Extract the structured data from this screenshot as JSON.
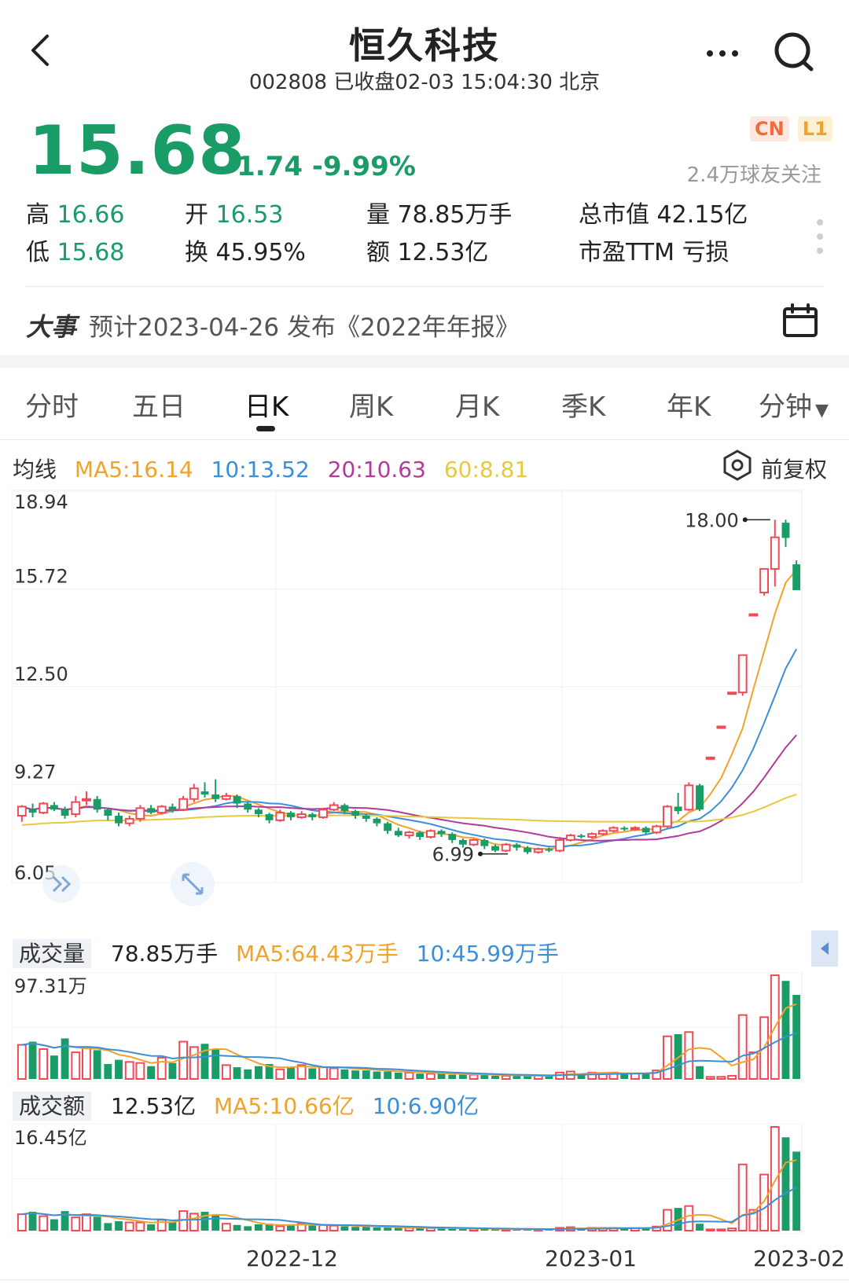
{
  "header": {
    "title": "恒久科技",
    "subtitle": "002808 已收盘02-03 15:04:30 北京"
  },
  "quote": {
    "price": "15.68",
    "change": "-1.74 -9.99%",
    "badges": [
      "CN",
      "L1"
    ],
    "followers": "2.4万球友关注",
    "stats": {
      "high_label": "高",
      "high": "16.66",
      "open_label": "开",
      "open": "16.53",
      "volume_label": "量",
      "volume": "78.85万手",
      "mktcap_label": "总市值",
      "mktcap": "42.15亿",
      "low_label": "低",
      "low": "15.68",
      "turnover_label": "换",
      "turnover": "45.95%",
      "amount_label": "额",
      "amount": "12.53亿",
      "pe_label": "市盈TTM",
      "pe": "亏损"
    }
  },
  "event": {
    "tag": "大事",
    "text": "预计2023-04-26 发布《2022年年报》"
  },
  "tabs": [
    {
      "label": "分时",
      "active": false
    },
    {
      "label": "五日",
      "active": false
    },
    {
      "label": "日K",
      "active": true
    },
    {
      "label": "周K",
      "active": false
    },
    {
      "label": "月K",
      "active": false
    },
    {
      "label": "季K",
      "active": false
    },
    {
      "label": "年K",
      "active": false
    },
    {
      "label": "分钟",
      "active": false
    }
  ],
  "ma_legend": {
    "label": "均线",
    "ma5": "MA5:16.14",
    "ma10": "10:13.52",
    "ma20": "20:10.63",
    "ma60": "60:8.81",
    "adjust": "前复权"
  },
  "volume_legend": {
    "label": "成交量",
    "value": "78.85万手",
    "ma5": "MA5:64.43万手",
    "ma10": "10:45.99万手",
    "axis_max": "97.31万"
  },
  "amount_legend": {
    "label": "成交额",
    "value": "12.53亿",
    "ma5": "MA5:10.66亿",
    "ma10": "10:6.90亿",
    "axis_max": "16.45亿"
  },
  "x_axis": [
    "2022-12",
    "2023-01",
    "2023-02"
  ],
  "colors": {
    "up": "#f24957",
    "down": "#1a9c67",
    "ma5": "#f1a22a",
    "ma10": "#3b8fd9",
    "ma20": "#b13a9a",
    "ma60": "#e8c93c"
  },
  "chart_data": [
    {
      "type": "candlestick",
      "title": "日K",
      "y_ticks": [
        18.94,
        15.72,
        12.5,
        9.27,
        6.05
      ],
      "ylim": [
        6.05,
        18.94
      ],
      "annotations": [
        {
          "label": "18.00",
          "value": 18.0
        },
        {
          "label": "6.99",
          "value": 6.99
        }
      ],
      "candles": [
        [
          8.25,
          8.55,
          8.6,
          8.05
        ],
        [
          8.45,
          8.35,
          8.65,
          8.2
        ],
        [
          8.35,
          8.65,
          8.7,
          8.3
        ],
        [
          8.6,
          8.45,
          8.7,
          8.4
        ],
        [
          8.45,
          8.25,
          8.55,
          8.15
        ],
        [
          8.3,
          8.7,
          8.9,
          8.2
        ],
        [
          8.75,
          8.8,
          9.05,
          8.6
        ],
        [
          8.8,
          8.45,
          8.9,
          8.35
        ],
        [
          8.45,
          8.25,
          8.5,
          8.1
        ],
        [
          8.25,
          8.0,
          8.35,
          7.9
        ],
        [
          8.0,
          8.15,
          8.25,
          7.9
        ],
        [
          8.15,
          8.5,
          8.6,
          8.05
        ],
        [
          8.5,
          8.35,
          8.6,
          8.3
        ],
        [
          8.35,
          8.55,
          8.6,
          8.3
        ],
        [
          8.55,
          8.45,
          8.65,
          8.35
        ],
        [
          8.45,
          8.8,
          8.9,
          8.4
        ],
        [
          8.8,
          9.15,
          9.3,
          8.7
        ],
        [
          9.05,
          8.95,
          9.35,
          8.85
        ],
        [
          8.95,
          8.8,
          9.45,
          8.7
        ],
        [
          8.8,
          8.9,
          9.0,
          8.75
        ],
        [
          8.9,
          8.65,
          8.95,
          8.5
        ],
        [
          8.65,
          8.45,
          8.7,
          8.35
        ],
        [
          8.45,
          8.3,
          8.5,
          8.2
        ],
        [
          8.3,
          8.1,
          8.35,
          8.0
        ],
        [
          8.1,
          8.35,
          8.45,
          8.05
        ],
        [
          8.35,
          8.2,
          8.4,
          8.1
        ],
        [
          8.2,
          8.3,
          8.4,
          8.15
        ],
        [
          8.3,
          8.2,
          8.35,
          8.1
        ],
        [
          8.2,
          8.45,
          8.5,
          8.15
        ],
        [
          8.45,
          8.6,
          8.7,
          8.4
        ],
        [
          8.6,
          8.4,
          8.65,
          8.3
        ],
        [
          8.4,
          8.25,
          8.45,
          8.15
        ],
        [
          8.25,
          8.15,
          8.3,
          8.05
        ],
        [
          8.15,
          8.0,
          8.2,
          7.9
        ],
        [
          8.0,
          7.75,
          8.05,
          7.65
        ],
        [
          7.75,
          7.6,
          7.85,
          7.55
        ],
        [
          7.6,
          7.7,
          7.75,
          7.5
        ],
        [
          7.7,
          7.55,
          7.75,
          7.45
        ],
        [
          7.55,
          7.75,
          7.8,
          7.5
        ],
        [
          7.75,
          7.65,
          7.8,
          7.55
        ],
        [
          7.65,
          7.45,
          7.7,
          7.35
        ],
        [
          7.45,
          7.3,
          7.5,
          7.2
        ],
        [
          7.3,
          7.45,
          7.5,
          7.25
        ],
        [
          7.45,
          7.25,
          7.5,
          7.15
        ],
        [
          7.25,
          7.1,
          7.3,
          7.05
        ],
        [
          7.1,
          7.3,
          7.35,
          7.05
        ],
        [
          7.3,
          7.2,
          7.35,
          7.1
        ],
        [
          7.2,
          7.05,
          7.25,
          6.99
        ],
        [
          7.05,
          7.15,
          7.2,
          7.0
        ],
        [
          7.15,
          7.1,
          7.2,
          7.05
        ],
        [
          7.1,
          7.45,
          7.55,
          7.05
        ],
        [
          7.45,
          7.6,
          7.65,
          7.4
        ],
        [
          7.6,
          7.55,
          7.65,
          7.5
        ],
        [
          7.55,
          7.65,
          7.7,
          7.5
        ],
        [
          7.65,
          7.75,
          7.8,
          7.6
        ],
        [
          7.75,
          7.85,
          7.9,
          7.7
        ],
        [
          7.85,
          7.8,
          7.9,
          7.75
        ],
        [
          7.8,
          7.85,
          7.9,
          7.75
        ],
        [
          7.85,
          7.7,
          7.9,
          7.65
        ],
        [
          7.7,
          7.9,
          7.95,
          7.65
        ],
        [
          7.9,
          8.55,
          8.6,
          7.85
        ],
        [
          8.55,
          8.4,
          9.0,
          8.3
        ],
        [
          8.45,
          9.25,
          9.35,
          8.4
        ],
        [
          9.25,
          8.45,
          9.3,
          8.4
        ],
        [
          10.17,
          10.17,
          10.17,
          10.17
        ],
        [
          11.19,
          11.19,
          11.19,
          11.19
        ],
        [
          12.31,
          12.31,
          12.31,
          12.31
        ],
        [
          12.31,
          13.54,
          13.54,
          12.2
        ],
        [
          14.89,
          14.89,
          14.89,
          14.89
        ],
        [
          15.6,
          16.38,
          16.38,
          15.5
        ],
        [
          16.38,
          17.42,
          18.0,
          15.8
        ],
        [
          17.9,
          17.4,
          18.0,
          17.1
        ],
        [
          16.53,
          15.68,
          16.66,
          15.68
        ]
      ]
    },
    {
      "type": "bar",
      "title": "成交量",
      "unit": "万手",
      "ylim": [
        0,
        97.31
      ],
      "values": [
        32,
        35,
        28,
        22,
        38,
        25,
        30,
        27,
        14,
        18,
        16,
        15,
        12,
        20,
        15,
        35,
        30,
        33,
        28,
        13,
        11,
        9,
        12,
        14,
        9,
        11,
        13,
        10,
        11,
        10,
        9,
        8,
        8,
        7,
        7,
        6,
        6,
        5,
        5,
        5,
        4,
        4,
        4,
        4,
        3,
        3,
        3,
        3,
        3,
        3,
        6,
        7,
        5,
        6,
        5,
        6,
        5,
        5,
        5,
        8,
        40,
        42,
        44,
        12,
        2,
        2,
        3,
        60,
        25,
        58,
        97.31,
        92,
        78.85
      ]
    },
    {
      "type": "bar",
      "title": "成交额",
      "unit": "亿",
      "ylim": [
        0,
        16.45
      ],
      "values": [
        2.6,
        3.0,
        2.3,
        1.8,
        3.1,
        2.1,
        2.6,
        2.2,
        1.2,
        1.5,
        1.3,
        1.3,
        1.0,
        1.7,
        1.3,
        3.1,
        2.7,
        3.0,
        2.5,
        1.1,
        0.9,
        0.7,
        1.0,
        1.1,
        0.7,
        0.9,
        1.1,
        0.8,
        0.9,
        0.8,
        0.7,
        0.6,
        0.6,
        0.5,
        0.5,
        0.45,
        0.45,
        0.4,
        0.4,
        0.4,
        0.3,
        0.3,
        0.3,
        0.3,
        0.2,
        0.2,
        0.2,
        0.2,
        0.2,
        0.2,
        0.45,
        0.55,
        0.4,
        0.45,
        0.4,
        0.45,
        0.4,
        0.4,
        0.4,
        0.65,
        3.3,
        3.6,
        3.9,
        1.1,
        0.2,
        0.2,
        0.35,
        10.5,
        3.3,
        8.9,
        16.45,
        14.8,
        12.53
      ]
    }
  ]
}
